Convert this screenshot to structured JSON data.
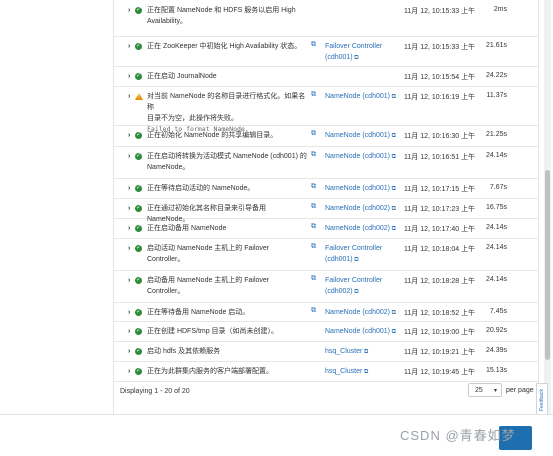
{
  "rows": [
    {
      "status": "ok",
      "desc1": "正在配置 NameNode 和 HDFS 服务以启用 High",
      "desc2": "Availability。",
      "role1": "",
      "role2": "",
      "time": "11月 12, 10:15:33 上午",
      "dur": "2ms",
      "ext": false
    },
    {
      "status": "ok",
      "desc1": "正在 ZooKeeper 中初始化 High Availability 状态。",
      "desc2": "",
      "role1": "Failover Controller",
      "role2": "(cdh001)",
      "time": "11月 12, 10:15:33 上午",
      "dur": "21.61s",
      "ext": true
    },
    {
      "status": "ok",
      "desc1": "正在启动 JournalNode",
      "desc2": "",
      "role1": "",
      "role2": "",
      "time": "11月 12, 10:15:54 上午",
      "dur": "24.22s",
      "ext": false
    },
    {
      "status": "warn",
      "desc1": "对当前 NameNode 的名称目录进行格式化。如果名称",
      "desc2": "目录不为空，此操作将失败。",
      "desc3": "Failed to format NameNode.",
      "role1": "NameNode (cdh001)",
      "role2": "",
      "time": "11月 12, 10:16:19 上午",
      "dur": "11.37s",
      "ext": true
    },
    {
      "status": "ok",
      "desc1": "正在初始化 NameNode 的共享编辑目录。",
      "desc2": "",
      "role1": "NameNode (cdh001)",
      "role2": "",
      "time": "11月 12, 10:16:30 上午",
      "dur": "21.25s",
      "ext": true
    },
    {
      "status": "ok",
      "desc1": "正在启动将转换为活动模式 NameNode (cdh001) 的",
      "desc2": "NameNode。",
      "role1": "NameNode (cdh001)",
      "role2": "",
      "time": "11月 12, 10:16:51 上午",
      "dur": "24.14s",
      "ext": true
    },
    {
      "status": "ok",
      "desc1": "正在等待启动活动的 NameNode。",
      "desc2": "",
      "role1": "NameNode (cdh001)",
      "role2": "",
      "time": "11月 12, 10:17:15 上午",
      "dur": "7.67s",
      "ext": true
    },
    {
      "status": "ok",
      "desc1": "正在通过初始化其名称目录来引导备用 NameNode。",
      "desc2": "",
      "role1": "NameNode (cdh002)",
      "role2": "",
      "time": "11月 12, 10:17:23 上午",
      "dur": "16.75s",
      "ext": true
    },
    {
      "status": "ok",
      "desc1": "正在启动备用 NameNode",
      "desc2": "",
      "role1": "NameNode (cdh002)",
      "role2": "",
      "time": "11月 12, 10:17:40 上午",
      "dur": "24.14s",
      "ext": true
    },
    {
      "status": "ok",
      "desc1": "启动活动 NameNode 主机上的 Failover Controller。",
      "desc2": "",
      "role1": "Failover Controller",
      "role2": "(cdh001)",
      "time": "11月 12, 10:18:04 上午",
      "dur": "24.14s",
      "ext": true
    },
    {
      "status": "ok",
      "desc1": "启动备用 NameNode 主机上的 Failover Controller。",
      "desc2": "",
      "role1": "Failover Controller",
      "role2": "(cdh002)",
      "time": "11月 12, 10:18:28 上午",
      "dur": "24.14s",
      "ext": true
    },
    {
      "status": "ok",
      "desc1": "正在等待备用 NameNode 启动。",
      "desc2": "",
      "role1": "NameNode (cdh002)",
      "role2": "",
      "time": "11月 12, 10:18:52 上午",
      "dur": "7.45s",
      "ext": true
    },
    {
      "status": "ok",
      "desc1": "正在创建 HDFS/tmp 目录（如尚未创建）。",
      "desc2": "",
      "role1": "NameNode (cdh001)",
      "role2": "",
      "time": "11月 12, 10:19:00 上午",
      "dur": "20.92s",
      "ext": false
    },
    {
      "status": "ok",
      "desc1": "启动 hdfs 及其依赖服务",
      "desc2": "",
      "role1": "hsq_Cluster",
      "role2": "",
      "time": "11月 12, 10:19:21 上午",
      "dur": "24.39s",
      "ext": false
    },
    {
      "status": "ok",
      "desc1": "正在为此群集内服务的客户端部署配置。",
      "desc2": "",
      "role1": "hsq_Cluster",
      "role2": "",
      "time": "11月 12, 10:19:45 上午",
      "dur": "15.13s",
      "ext": false
    }
  ],
  "footer": {
    "displaying": "Displaying 1 - 20 of 20",
    "page_size": "25",
    "per_page": "per page"
  },
  "feedback": "Feedback",
  "watermark": "CSDN @青春如梦"
}
